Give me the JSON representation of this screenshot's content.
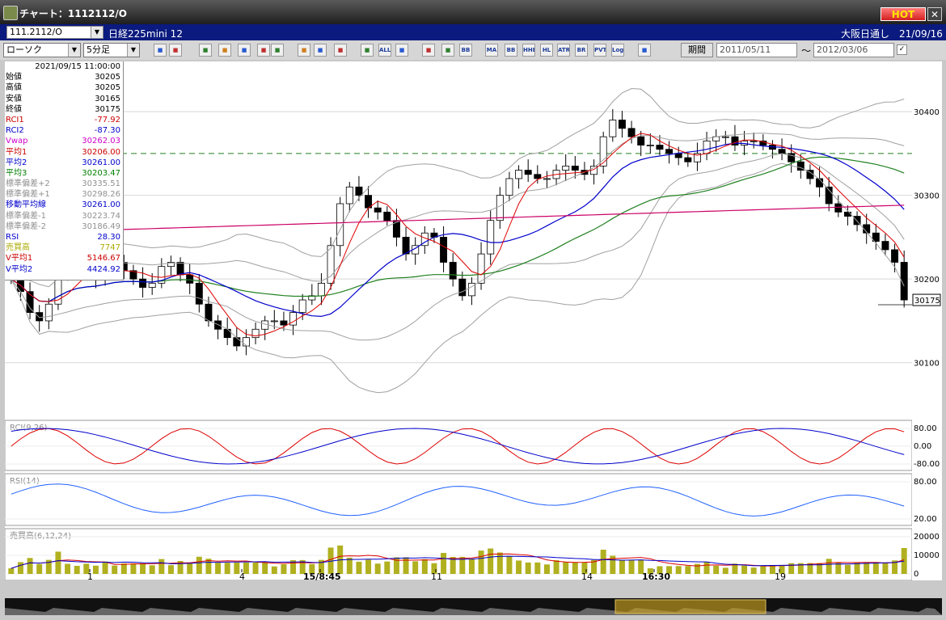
{
  "window": {
    "title": "チャート：1112112/O",
    "hot_label": "HOT",
    "close_label": "✕"
  },
  "symbol_bar": {
    "code": "111.2112/O",
    "instrument": "日経225mini 12",
    "session": "大阪日通し　21/09/16"
  },
  "toolbar": {
    "chart_type": "ローソク",
    "timeframe": "5分足",
    "buttons": [
      "zoom-icon",
      "cursor-icon",
      "trend-icon",
      "bar-icon",
      "ma-icon",
      "flag-icon",
      "pen-icon",
      "arrow-icon",
      "undo-icon",
      "candle-icon",
      "candle2-icon",
      "ALL",
      "brush-icon",
      "wrench-icon",
      "color-icon",
      "BB",
      "MA",
      "BB",
      "HHE",
      "HL",
      "ATR",
      "BR",
      "PVT",
      "Log",
      "save-icon"
    ],
    "period_label": "期間",
    "date_from": "2011/05/11",
    "date_to": "2012/03/06",
    "tilde": "～",
    "check": "✓"
  },
  "info_panel": {
    "datetime": "2021/09/15 11:00:00",
    "rows": [
      {
        "label": "始値",
        "value": "30205",
        "color": "#000000"
      },
      {
        "label": "高値",
        "value": "30205",
        "color": "#000000"
      },
      {
        "label": "安値",
        "value": "30165",
        "color": "#000000"
      },
      {
        "label": "終値",
        "value": "30175",
        "color": "#000000"
      },
      {
        "label": "RCI1",
        "value": "-77.92",
        "color": "#cc0000"
      },
      {
        "label": "RCI2",
        "value": "-87.30",
        "color": "#0000cc"
      },
      {
        "label": "Vwap",
        "value": "30262.03",
        "color": "#cc00cc"
      },
      {
        "label": "平均1",
        "value": "30206.00",
        "color": "#cc0000"
      },
      {
        "label": "平均2",
        "value": "30261.00",
        "color": "#0000cc"
      },
      {
        "label": "平均3",
        "value": "30203.47",
        "color": "#008000"
      },
      {
        "label": "標準偏差+2",
        "value": "30335.51",
        "color": "#909090"
      },
      {
        "label": "標準偏差+1",
        "value": "30298.26",
        "color": "#909090"
      },
      {
        "label": "移動平均線",
        "value": "30261.00",
        "color": "#0000cc"
      },
      {
        "label": "標準偏差-1",
        "value": "30223.74",
        "color": "#909090"
      },
      {
        "label": "標準偏差-2",
        "value": "30186.49",
        "color": "#909090"
      },
      {
        "label": "RSI",
        "value": "28.30",
        "color": "#0000cc"
      },
      {
        "label": "売買高",
        "value": "7747",
        "color": "#aaaa00"
      },
      {
        "label": "V平均1",
        "value": "5146.67",
        "color": "#cc0000"
      },
      {
        "label": "V平均2",
        "value": "4424.92",
        "color": "#0000cc"
      }
    ]
  },
  "chart_data": {
    "type": "candlestick",
    "price_axis": {
      "ticks": [
        30400,
        30300,
        30200,
        30100
      ],
      "ylim": [
        30035,
        30460
      ],
      "current": "30175"
    },
    "reference_level": 30350,
    "x_tick_labels": [
      "1",
      "4",
      "15/8:45",
      "11",
      "14",
      "16:30",
      "19"
    ],
    "close_series": [
      30200,
      30185,
      30160,
      30150,
      30170,
      30210,
      30220,
      30215,
      30205,
      30200,
      30215,
      30220,
      30210,
      30200,
      30190,
      30195,
      30215,
      30220,
      30205,
      30195,
      30170,
      30150,
      30140,
      30130,
      30120,
      30130,
      30140,
      30150,
      30150,
      30145,
      30160,
      30175,
      30180,
      30195,
      30240,
      30290,
      30310,
      30300,
      30285,
      30280,
      30270,
      30250,
      30230,
      30240,
      30255,
      30250,
      30220,
      30200,
      30180,
      30195,
      30230,
      30270,
      30300,
      30320,
      30330,
      30325,
      30320,
      30320,
      30330,
      30335,
      30330,
      30325,
      30335,
      30370,
      30390,
      30380,
      30370,
      30360,
      30360,
      30355,
      30350,
      30345,
      30340,
      30350,
      30365,
      30370,
      30370,
      30360,
      30365,
      30365,
      30360,
      30355,
      30350,
      30340,
      30330,
      30320,
      30310,
      30290,
      30280,
      30275,
      30265,
      30255,
      30245,
      30235,
      30220,
      30175
    ],
    "rci_panel": {
      "label": "RCI(9,26)",
      "ticks": [
        "80.00",
        "0.00",
        "-80.00"
      ]
    },
    "rsi_panel": {
      "label": "RSI(14)",
      "ticks": [
        "80.00",
        "20.00"
      ]
    },
    "volume_panel": {
      "label": "売買高(6,12,24)",
      "ticks": [
        "20000",
        "10000",
        "0"
      ]
    },
    "colors": {
      "candle_up": "#ffffff",
      "candle_down": "#000000",
      "ma1": "#dd0000",
      "ma2": "#0000cc",
      "ma3": "#208020",
      "vwap": "#cc0066",
      "bb": "#a0a0a0",
      "reference": "#208020",
      "rsi": "#2060ff",
      "volume": "#b0b020"
    }
  }
}
